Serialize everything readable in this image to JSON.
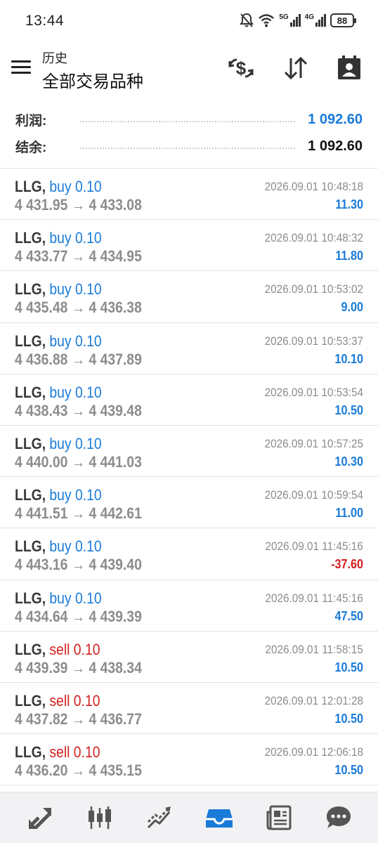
{
  "status_bar": {
    "time": "13:44",
    "network_5g": "5G",
    "network_4g": "4G",
    "battery": "88"
  },
  "header": {
    "title_small": "历史",
    "title_big": "全部交易品种",
    "actions": [
      "dollar-swap-icon",
      "sort-arrows-icon",
      "calendar-person-icon"
    ]
  },
  "summary": {
    "profit_label": "利润:",
    "profit_value": "1 092.60",
    "balance_label": "结余:",
    "balance_value": "1 092.60"
  },
  "colors": {
    "accent_blue": "#1a7bd8",
    "negative_red": "#d32020",
    "text_gray": "#8c8c8c"
  },
  "trades": [
    {
      "symbol": "LLG,",
      "direction": "buy 0.10",
      "type": "buy",
      "prices": "4 431.95 → 4 433.08",
      "time": "2026.09.01 10:48:18",
      "profit": "11.30"
    },
    {
      "symbol": "LLG,",
      "direction": "buy 0.10",
      "type": "buy",
      "prices": "4 433.77 → 4 434.95",
      "time": "2026.09.01 10:48:32",
      "profit": "11.80"
    },
    {
      "symbol": "LLG,",
      "direction": "buy 0.10",
      "type": "buy",
      "prices": "4 435.48 → 4 436.38",
      "time": "2026.09.01 10:53:02",
      "profit": "9.00"
    },
    {
      "symbol": "LLG,",
      "direction": "buy 0.10",
      "type": "buy",
      "prices": "4 436.88 → 4 437.89",
      "time": "2026.09.01 10:53:37",
      "profit": "10.10"
    },
    {
      "symbol": "LLG,",
      "direction": "buy 0.10",
      "type": "buy",
      "prices": "4 438.43 → 4 439.48",
      "time": "2026.09.01 10:53:54",
      "profit": "10.50"
    },
    {
      "symbol": "LLG,",
      "direction": "buy 0.10",
      "type": "buy",
      "prices": "4 440.00 → 4 441.03",
      "time": "2026.09.01 10:57:25",
      "profit": "10.30"
    },
    {
      "symbol": "LLG,",
      "direction": "buy 0.10",
      "type": "buy",
      "prices": "4 441.51 → 4 442.61",
      "time": "2026.09.01 10:59:54",
      "profit": "11.00"
    },
    {
      "symbol": "LLG,",
      "direction": "buy 0.10",
      "type": "buy",
      "prices": "4 443.16 → 4 439.40",
      "time": "2026.09.01 11:45:16",
      "profit": "-37.60"
    },
    {
      "symbol": "LLG,",
      "direction": "buy 0.10",
      "type": "buy",
      "prices": "4 434.64 → 4 439.39",
      "time": "2026.09.01 11:45:16",
      "profit": "47.50"
    },
    {
      "symbol": "LLG,",
      "direction": "sell 0.10",
      "type": "sell",
      "prices": "4 439.39 → 4 438.34",
      "time": "2026.09.01 11:58:15",
      "profit": "10.50"
    },
    {
      "symbol": "LLG,",
      "direction": "sell 0.10",
      "type": "sell",
      "prices": "4 437.82 → 4 436.77",
      "time": "2026.09.01 12:01:28",
      "profit": "10.50"
    },
    {
      "symbol": "LLG,",
      "direction": "sell 0.10",
      "type": "sell",
      "prices": "4 436.20 → 4 435.15",
      "time": "2026.09.01 12:06:18",
      "profit": "10.50"
    }
  ],
  "bottom_nav": {
    "items": [
      "quotes-icon",
      "chart-icon",
      "trade-icon",
      "history-icon",
      "news-icon",
      "chat-icon"
    ],
    "active": "history-icon"
  }
}
